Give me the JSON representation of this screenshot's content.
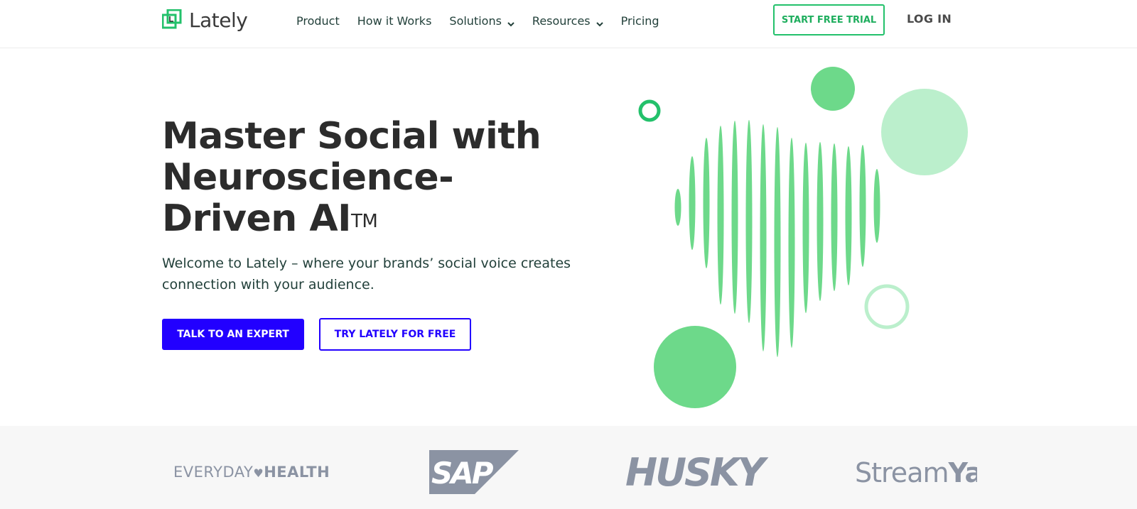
{
  "brand": {
    "name": "Lately",
    "accent_green": "#23c16b",
    "cta_blue": "#2200ff"
  },
  "nav": {
    "items": [
      {
        "label": "Product",
        "has_dropdown": false
      },
      {
        "label": "How it Works",
        "has_dropdown": false
      },
      {
        "label": "Solutions",
        "has_dropdown": true
      },
      {
        "label": "Resources",
        "has_dropdown": true
      },
      {
        "label": "Pricing",
        "has_dropdown": false
      }
    ],
    "start_trial_label": "START FREE TRIAL",
    "login_label": "LOG IN"
  },
  "hero": {
    "title_line1": "Master Social with",
    "title_line2": "Neuroscience-",
    "title_line3": "Driven AI",
    "title_tm": "TM",
    "subtitle": "Welcome to Lately – where your brands’ social voice creates connection with your audience.",
    "primary_button": "TALK TO AN EXPERT",
    "secondary_button": "TRY LATELY FOR FREE",
    "illustration": "heart-soundwave-illustration"
  },
  "logos": {
    "everyday_health_thin": "EVERYDAY",
    "everyday_health_bold": "HEALTH",
    "sap": "SAP",
    "husky": "HUSKY",
    "streamyard_thin": "Stream",
    "streamyard_bold": "Yard",
    "logo_color": "#8b93a3"
  }
}
